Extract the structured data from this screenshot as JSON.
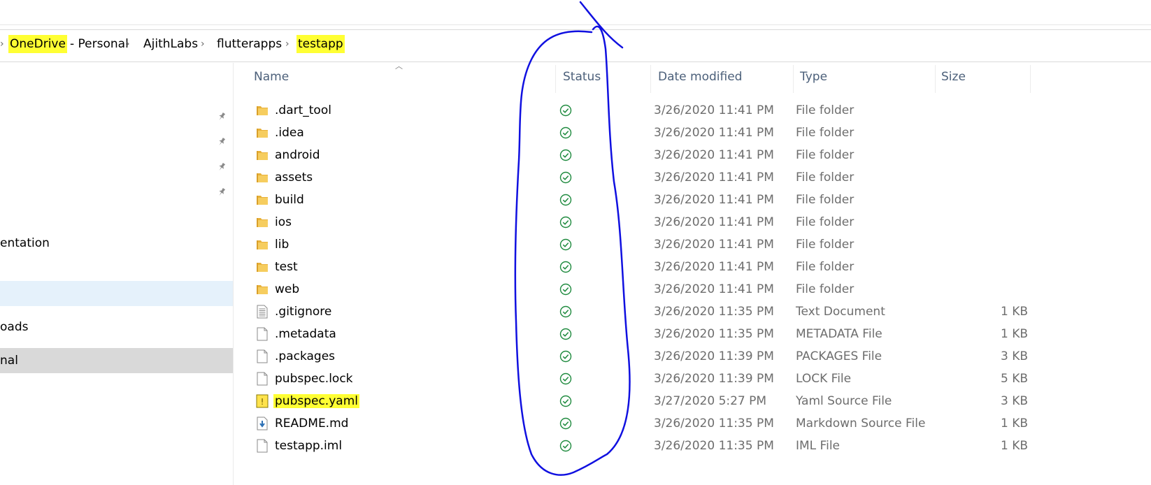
{
  "breadcrumb": {
    "items": [
      {
        "label": "OneDrive",
        "highlight": true
      },
      {
        "label": "- Personal",
        "highlight": false
      },
      {
        "label": "AjithLabs",
        "highlight": false
      },
      {
        "label": "flutterapps",
        "highlight": false
      },
      {
        "label": "testapp",
        "highlight": true
      }
    ],
    "separator": "›"
  },
  "nav": {
    "items": [
      {
        "label": "entation"
      },
      {
        "label": ""
      },
      {
        "label": "oads"
      },
      {
        "label": "nal"
      }
    ]
  },
  "columns": {
    "name": "Name",
    "status": "Status",
    "date": "Date modified",
    "type": "Type",
    "size": "Size"
  },
  "files": [
    {
      "name": ".dart_tool",
      "date": "3/26/2020 11:41 PM",
      "type": "File folder",
      "size": "",
      "icon": "folder-icon"
    },
    {
      "name": ".idea",
      "date": "3/26/2020 11:41 PM",
      "type": "File folder",
      "size": "",
      "icon": "folder-icon"
    },
    {
      "name": "android",
      "date": "3/26/2020 11:41 PM",
      "type": "File folder",
      "size": "",
      "icon": "folder-icon"
    },
    {
      "name": "assets",
      "date": "3/26/2020 11:41 PM",
      "type": "File folder",
      "size": "",
      "icon": "folder-icon"
    },
    {
      "name": "build",
      "date": "3/26/2020 11:41 PM",
      "type": "File folder",
      "size": "",
      "icon": "folder-icon"
    },
    {
      "name": "ios",
      "date": "3/26/2020 11:41 PM",
      "type": "File folder",
      "size": "",
      "icon": "folder-icon"
    },
    {
      "name": "lib",
      "date": "3/26/2020 11:41 PM",
      "type": "File folder",
      "size": "",
      "icon": "folder-icon"
    },
    {
      "name": "test",
      "date": "3/26/2020 11:41 PM",
      "type": "File folder",
      "size": "",
      "icon": "folder-icon"
    },
    {
      "name": "web",
      "date": "3/26/2020 11:41 PM",
      "type": "File folder",
      "size": "",
      "icon": "folder-icon"
    },
    {
      "name": ".gitignore",
      "date": "3/26/2020 11:35 PM",
      "type": "Text Document",
      "size": "1 KB",
      "icon": "text-document-icon"
    },
    {
      "name": ".metadata",
      "date": "3/26/2020 11:35 PM",
      "type": "METADATA File",
      "size": "1 KB",
      "icon": "file-icon"
    },
    {
      "name": ".packages",
      "date": "3/26/2020 11:39 PM",
      "type": "PACKAGES File",
      "size": "3 KB",
      "icon": "file-icon"
    },
    {
      "name": "pubspec.lock",
      "date": "3/26/2020 11:39 PM",
      "type": "LOCK File",
      "size": "5 KB",
      "icon": "file-icon"
    },
    {
      "name": "pubspec.yaml",
      "date": "3/27/2020 5:27 PM",
      "type": "Yaml Source File",
      "size": "3 KB",
      "icon": "yaml-warning-icon",
      "highlight": true
    },
    {
      "name": "README.md",
      "date": "3/26/2020 11:35 PM",
      "type": "Markdown Source File",
      "size": "1 KB",
      "icon": "markdown-file-icon"
    },
    {
      "name": "testapp.iml",
      "date": "3/26/2020 11:35 PM",
      "type": "IML File",
      "size": "1 KB",
      "icon": "file-icon"
    }
  ],
  "status_icon": "synced-check-icon",
  "colors": {
    "highlight": "#ffff33",
    "sync_green": "#1e8a3e",
    "annotation_ink": "#1010e0",
    "header_text": "#4c607a",
    "nav_hover": "#e5f1fb",
    "nav_selected": "#d9d9d9"
  }
}
